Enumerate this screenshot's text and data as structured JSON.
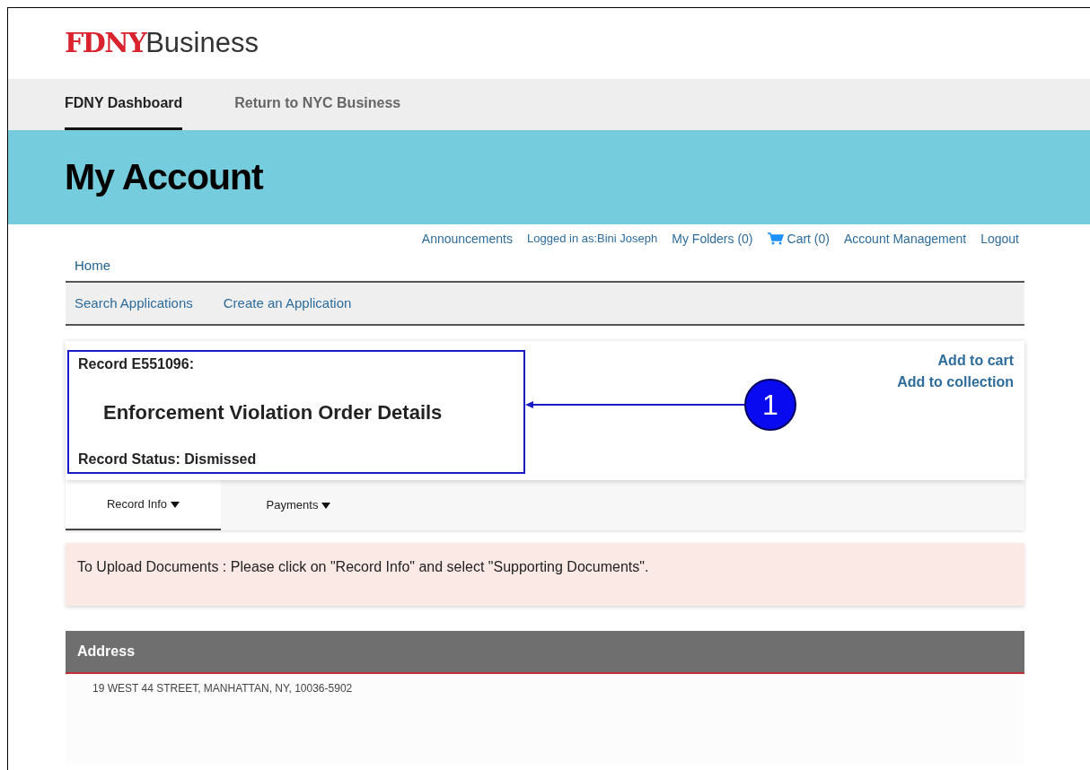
{
  "logo": {
    "brand": "FDNY",
    "product": "Business"
  },
  "nav": [
    {
      "label": "FDNY Dashboard",
      "selected": true
    },
    {
      "label": "Return to NYC Business",
      "selected": false
    }
  ],
  "banner": {
    "title": "My Account"
  },
  "account_links": [
    {
      "kind": "link",
      "label": "Announcements"
    },
    {
      "kind": "user",
      "label": "Logged in as:Bini Joseph"
    },
    {
      "kind": "link",
      "label": "My Folders (0)"
    },
    {
      "kind": "cart",
      "label": "Cart (0)"
    },
    {
      "kind": "link",
      "label": "Account Management"
    },
    {
      "kind": "link",
      "label": "Logout"
    }
  ],
  "home": "Home",
  "subnav": [
    "Search Applications",
    "Create an Application"
  ],
  "record": {
    "number": "Record E551096:",
    "title": "Enforcement Violation Order Details",
    "status": "Record Status: Dismissed",
    "actions": [
      "Add to cart",
      "Add to collection"
    ],
    "callout": "1"
  },
  "tabs": [
    {
      "label": "Record Info",
      "selected": true
    },
    {
      "label": "Payments",
      "selected": false
    }
  ],
  "notice": "To Upload Documents : Please click on \"Record Info\" and select \"Supporting Documents\".",
  "address": {
    "heading": "Address",
    "value": "19 WEST 44 STREET, MANHATTAN, NY, 10036-5902"
  }
}
